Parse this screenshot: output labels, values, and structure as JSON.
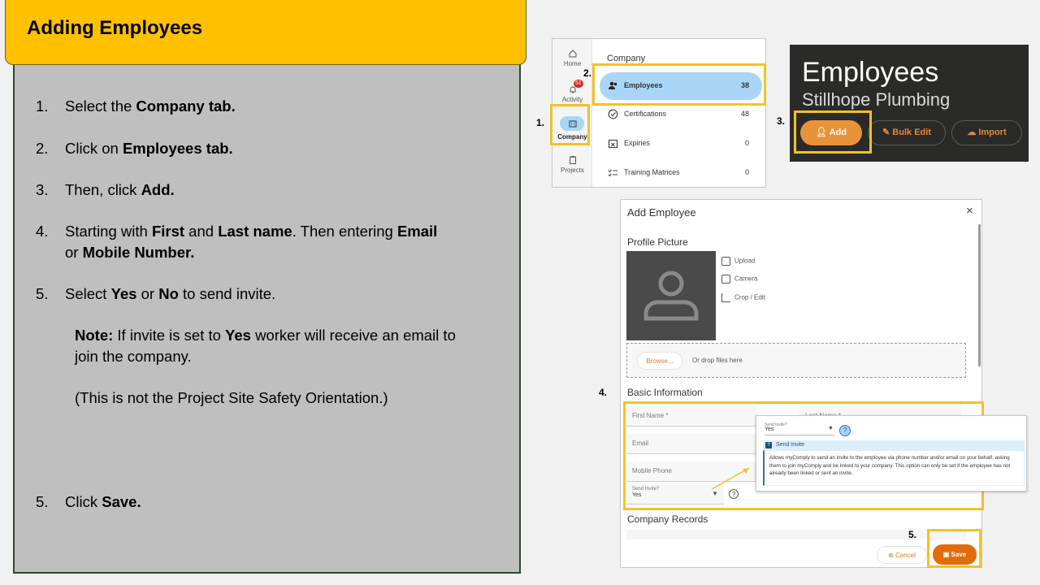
{
  "title": "Adding Employees",
  "steps": [
    {
      "num": "1.",
      "a": "Select the ",
      "b": "Company tab."
    },
    {
      "num": "2.",
      "a": "Click on ",
      "b": "Employees tab."
    },
    {
      "num": "3.",
      "a": "Then, click ",
      "b": "Add."
    },
    {
      "num": "4.",
      "a": "Starting with ",
      "b": "First",
      "c": " and ",
      "d": "Last name",
      "e": ". Then entering ",
      "f": "Email",
      "g": " or ",
      "h": "Mobile Number."
    },
    {
      "num": "5.",
      "a": "Select ",
      "b": "Yes",
      "c": " or ",
      "d": "No",
      "e": " to send invite."
    },
    {
      "num": "5.",
      "a": "Click ",
      "b": "Save."
    }
  ],
  "note": {
    "label": "Note:",
    "a": " If invite is set to ",
    "b": "Yes",
    "c": " worker will receive an email to join the company.",
    "paren": "(This is not the Project Site Safety Orientation.)"
  },
  "markers": {
    "m1": "1.",
    "m2": "2.",
    "m3": "3.",
    "m4": "4.",
    "m5": "5."
  },
  "nav": {
    "rail": [
      {
        "label": "Home",
        "icon": "home-icon"
      },
      {
        "label": "Activity",
        "icon": "bell-icon",
        "badge": "51"
      },
      {
        "label": "Company",
        "icon": "building-icon"
      },
      {
        "label": "Projects",
        "icon": "clipboard-icon"
      }
    ],
    "section_title": "Company",
    "rows": [
      {
        "label": "Employees",
        "count": "38",
        "icon": "people-icon"
      },
      {
        "label": "Certifications",
        "count": "48",
        "icon": "check-circle-icon"
      },
      {
        "label": "Expiries",
        "count": "0",
        "icon": "calendar-x-icon"
      },
      {
        "label": "Training Matrices",
        "count": "0",
        "icon": "checklist-icon"
      }
    ]
  },
  "employees_header": {
    "title": "Employees",
    "subtitle": "Stillhope Plumbing",
    "buttons": [
      "Add",
      "Bulk Edit",
      "Import"
    ]
  },
  "dialog": {
    "title": "Add Employee",
    "close": "×",
    "profile_label": "Profile Picture",
    "actions": [
      "Upload",
      "Camera",
      "Crop / Edit"
    ],
    "browse": "Browse...",
    "drop_text": "Or drop files here",
    "basic_label": "Basic Information",
    "fields": {
      "first": "First Name *",
      "last": "Last Name *",
      "email": "Email",
      "mobile": "Mobile Phone",
      "send_label": "Send Invite?",
      "send_value": "Yes"
    },
    "records_label": "Company Records",
    "cancel": "Cancel",
    "save": "Save"
  },
  "tooltip": {
    "send_label": "Send Invite?",
    "send_value": "Yes",
    "help": "?",
    "heading": "Send Invite",
    "body": "Allows myComply to send an invite to the employee via phone number and/or email on your behalf, asking them to join myComply and be linked to your company. This option can only be set if the employee has not already been linked or sent an invite."
  },
  "colors": {
    "accent": "#ffc000",
    "highlight": "#f3c12a",
    "panel": "#bfbfbf",
    "orange": "#e36c0a",
    "nav_active": "#a9d6f6"
  }
}
